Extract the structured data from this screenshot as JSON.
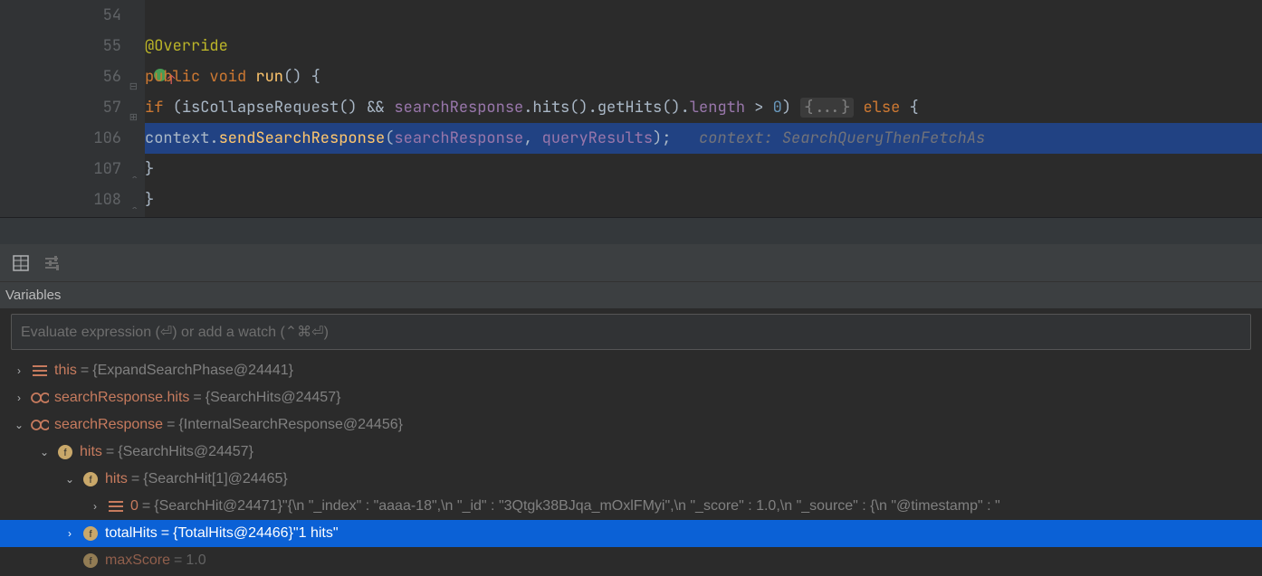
{
  "editor": {
    "lines": [
      {
        "num": "54",
        "tokens": []
      },
      {
        "num": "55",
        "tokens": [
          {
            "cls": "ann",
            "t": "@Override"
          }
        ],
        "indent": "indent1"
      },
      {
        "num": "56",
        "tokens": [
          {
            "cls": "kw",
            "t": "public "
          },
          {
            "cls": "kw",
            "t": "void "
          },
          {
            "cls": "mtd",
            "t": "run"
          },
          {
            "cls": "pln",
            "t": "() {"
          }
        ],
        "indent": "indent1",
        "gutterIcon": "override",
        "fold": "minus"
      },
      {
        "num": "57",
        "tokens": [
          {
            "cls": "kw",
            "t": "if "
          },
          {
            "cls": "pln",
            "t": "("
          },
          {
            "cls": "pln",
            "t": "isCollapseRequest() && "
          },
          {
            "cls": "param",
            "t": "searchResponse"
          },
          {
            "cls": "pln",
            "t": ".hits().getHits()."
          },
          {
            "cls": "param",
            "t": "length"
          },
          {
            "cls": "pln",
            "t": " > "
          },
          {
            "cls": "num",
            "t": "0"
          },
          {
            "cls": "pln",
            "t": ") "
          },
          {
            "cls": "fold",
            "t": "{...}"
          },
          {
            "cls": "pln",
            "t": " "
          },
          {
            "cls": "kw",
            "t": "else"
          },
          {
            "cls": "pln",
            "t": " {"
          }
        ],
        "indent": "indent2",
        "fold": "plus"
      },
      {
        "num": "106",
        "current": true,
        "tokens": [
          {
            "cls": "pln",
            "t": "context."
          },
          {
            "cls": "mtd",
            "t": "sendSearchResponse"
          },
          {
            "cls": "pln",
            "t": "("
          },
          {
            "cls": "param",
            "t": "searchResponse"
          },
          {
            "cls": "pln",
            "t": ", "
          },
          {
            "cls": "param",
            "t": "queryResults"
          },
          {
            "cls": "pln",
            "t": ");   "
          },
          {
            "cls": "hint",
            "t": "context: SearchQueryThenFetchAs"
          }
        ],
        "indent": "indent3",
        "gutterIcon": "breakpoint"
      },
      {
        "num": "107",
        "tokens": [
          {
            "cls": "pln",
            "t": "}"
          }
        ],
        "indent": "indent2",
        "fold": "up"
      },
      {
        "num": "108",
        "tokens": [
          {
            "cls": "pln",
            "t": "}"
          }
        ],
        "indent": "indent1",
        "fold": "up"
      }
    ]
  },
  "panel": {
    "title": "Variables",
    "evalPlaceholder": "Evaluate expression (⏎) or add a watch (⌃⌘⏎)"
  },
  "variables": [
    {
      "depth": 0,
      "chev": ">",
      "icon": "bars",
      "name": "this",
      "value": "{ExpandSearchPhase@24441}"
    },
    {
      "depth": 0,
      "chev": ">",
      "icon": "glasses",
      "name": "searchResponse.hits",
      "value": "{SearchHits@24457}"
    },
    {
      "depth": 0,
      "chev": "v",
      "icon": "glasses",
      "name": "searchResponse",
      "value": "{InternalSearchResponse@24456}"
    },
    {
      "depth": 1,
      "chev": "v",
      "icon": "field",
      "name": "hits",
      "value": "{SearchHits@24457}"
    },
    {
      "depth": 2,
      "chev": "v",
      "icon": "field",
      "name": "hits",
      "value": "{SearchHit[1]@24465}"
    },
    {
      "depth": 3,
      "chev": ">",
      "icon": "bars",
      "name": "0",
      "value": "{SearchHit@24471}",
      "string": "\"{\\n  \"_index\" : \"aaaa-18\",\\n  \"_id\" : \"3Qtgk38BJqa_mOxlFMyi\",\\n  \"_score\" : 1.0,\\n  \"_source\" : {\\n    \"@timestamp\" : \""
    },
    {
      "depth": 2,
      "chev": ">",
      "icon": "field",
      "name": "totalHits",
      "value": "{TotalHits@24466}",
      "string": "\"1 hits\"",
      "selected": true
    },
    {
      "depth": 2,
      "chev": "",
      "icon": "field",
      "name": "maxScore",
      "value": "1.0",
      "faded": true
    }
  ]
}
